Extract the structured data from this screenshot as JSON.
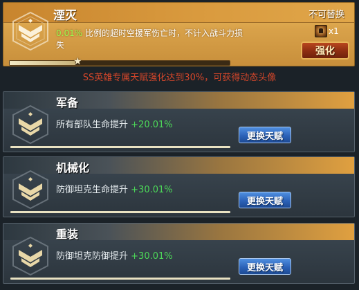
{
  "featured": {
    "title": "湮灭",
    "tag": "不可替换",
    "description_highlight": "0.01%",
    "description": "比例的超时空援军伤亡时，不计入战斗力损失",
    "item_count": "x1",
    "button_label": "强化",
    "progress": 0.3
  },
  "notice": "SS英雄专属天赋强化达到30%，可获得动态头像",
  "talents": [
    {
      "title": "军备",
      "desc": "所有部队生命提升",
      "value": "+20.01%",
      "button_label": "更换天赋"
    },
    {
      "title": "机械化",
      "desc": "防御坦克生命提升",
      "value": "+30.01%",
      "button_label": "更换天赋"
    },
    {
      "title": "重装",
      "desc": "防御坦克防御提升",
      "value": "+30.01%",
      "button_label": "更换天赋"
    }
  ],
  "colors": {
    "gold_card": "#d9a24a",
    "highlight_green": "#9dff4f",
    "value_green": "#4cd858",
    "notice_red": "#d2462a",
    "button_blue": "#2c62b8"
  },
  "icons": {
    "emblem": "rank-chevron-icon",
    "item": "portrait-item-icon",
    "progress_marker": "star-icon"
  }
}
